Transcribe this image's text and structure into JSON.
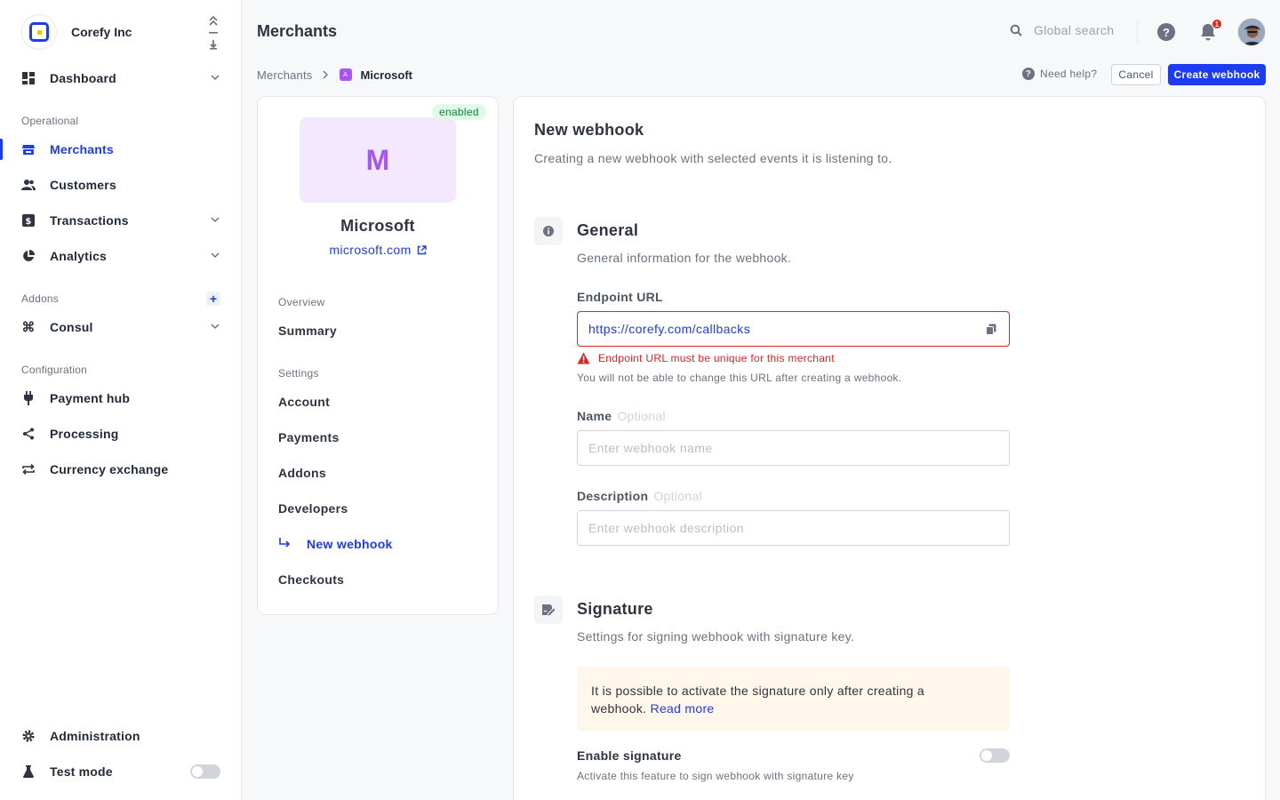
{
  "org": {
    "name": "Corefy Inc"
  },
  "sidebar": {
    "items": [
      {
        "label": "Dashboard",
        "icon": "dashboard-icon"
      },
      {
        "label": "Merchants",
        "icon": "store-icon"
      },
      {
        "label": "Customers",
        "icon": "users-icon"
      },
      {
        "label": "Transactions",
        "icon": "dollar-icon"
      },
      {
        "label": "Analytics",
        "icon": "pie-chart-icon"
      },
      {
        "label": "Consul",
        "icon": "command-icon"
      },
      {
        "label": "Payment hub",
        "icon": "plug-icon"
      },
      {
        "label": "Processing",
        "icon": "share-icon"
      },
      {
        "label": "Currency exchange",
        "icon": "exchange-icon"
      },
      {
        "label": "Administration",
        "icon": "gear-icon"
      },
      {
        "label": "Test mode",
        "icon": "flask-icon"
      }
    ],
    "sections": {
      "operational": "Operational",
      "addons": "Addons",
      "configuration": "Configuration"
    },
    "active": "Merchants",
    "test_mode_on": false
  },
  "header": {
    "title": "Merchants",
    "search_placeholder": "Global search",
    "notifications_count": "1"
  },
  "breadcrumb": {
    "parent": "Merchants",
    "current": "Microsoft",
    "logo_letter": "A"
  },
  "actions": {
    "need_help": "Need help?",
    "cancel": "Cancel",
    "create": "Create webhook"
  },
  "merchant": {
    "status": "enabled",
    "initial": "M",
    "name": "Microsoft",
    "domain": "microsoft.com"
  },
  "merchant_nav": {
    "overview_label": "Overview",
    "summary": "Summary",
    "settings_label": "Settings",
    "items": [
      "Account",
      "Payments",
      "Addons",
      "Developers",
      "New webhook",
      "Checkouts"
    ]
  },
  "form": {
    "title": "New webhook",
    "subtitle": "Creating a new webhook with selected events it is listening to.",
    "general": {
      "title": "General",
      "subtitle": "General information for the webhook.",
      "endpoint_label": "Endpoint URL",
      "endpoint_value": "https://corefy.com/callbacks",
      "endpoint_error": "Endpoint URL must be unique for this merchant",
      "endpoint_hint": "You will not be able to change this URL after creating a webhook.",
      "name_label": "Name",
      "name_optional": "Optional",
      "name_placeholder": "Enter webhook name",
      "description_label": "Description",
      "description_optional": "Optional",
      "description_placeholder": "Enter webhook description"
    },
    "signature": {
      "title": "Signature",
      "subtitle": "Settings for signing webhook with signature key.",
      "notice_line1": "It is possible to activate the signature only after creating a",
      "notice_line2": "webhook.",
      "notice_link": "Read more",
      "enable_label": "Enable signature",
      "enable_hint": "Activate this feature to sign webhook with signature key",
      "enabled": false
    }
  },
  "colors": {
    "accent": "#1d3cf2",
    "error": "#dc2626",
    "success": "#15803d"
  }
}
